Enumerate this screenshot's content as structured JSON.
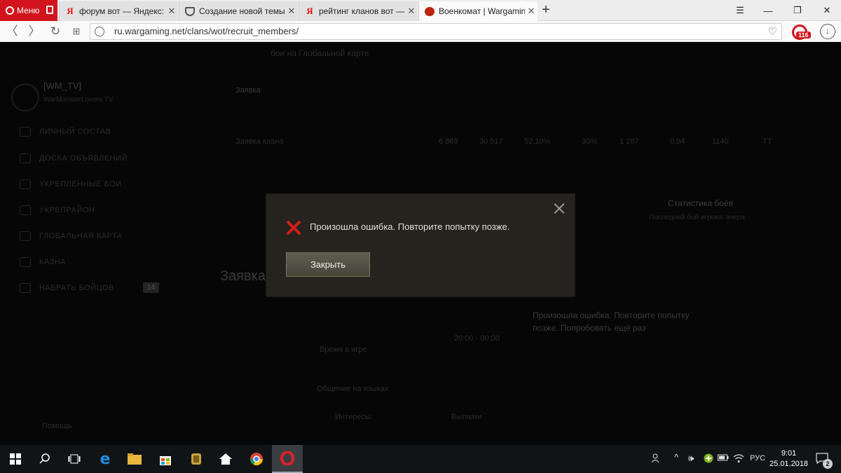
{
  "browser": {
    "menu_label": "Меню",
    "tabs": [
      {
        "title": "форум вот — Яндекс: нас",
        "icon": "yandex"
      },
      {
        "title": "Создание новой темы - С",
        "icon": "shield"
      },
      {
        "title": "рейтинг кланов вот — Ян",
        "icon": "yandex"
      },
      {
        "title": "Военкомат | Wargaming.n",
        "icon": "wargaming",
        "active": true
      }
    ],
    "url": "ru.wargaming.net/clans/wot/recruit_members/",
    "extension_badge": "116"
  },
  "page": {
    "top_text": "бои на Глобальной карте",
    "clan_name": "[WM_TV]",
    "clan_sub": "WarMonsterLovers TV",
    "sidebar_items": [
      "Личный состав",
      "Доска объявлений",
      "Укрепленные бои",
      "Укрепрайон",
      "Глобальная карта",
      "Казна",
      "Набрать бойцов"
    ],
    "recruit_badge": "14",
    "table_headers": [
      "Заявка"
    ],
    "row_name": "Заявка клана",
    "row_values": [
      "6 869",
      "30 517",
      "52,10%",
      "30%",
      "1 287",
      "0,94",
      "1140",
      "ТТ"
    ],
    "stats_title": "Статистика боёв",
    "stats_sub": "Последний бой игрока: вчера",
    "section_title": "Заявка",
    "bg_error": "Произошла ошибка. Повторите попытку позже. Попробовать ещё раз",
    "time_label": "Время в игре",
    "time_value": "20:00 - 00:00",
    "lang_label": "Общение на языках",
    "interests_label": "Интересы",
    "interests_value": "Вылазки",
    "help_label": "Помощь"
  },
  "modal": {
    "message": "Произошла ошибка. Повторите попытку позже.",
    "button_label": "Закрыть"
  },
  "taskbar": {
    "lang": "РУС",
    "time": "9:01",
    "date": "25.01.2018",
    "notifications": "2"
  }
}
